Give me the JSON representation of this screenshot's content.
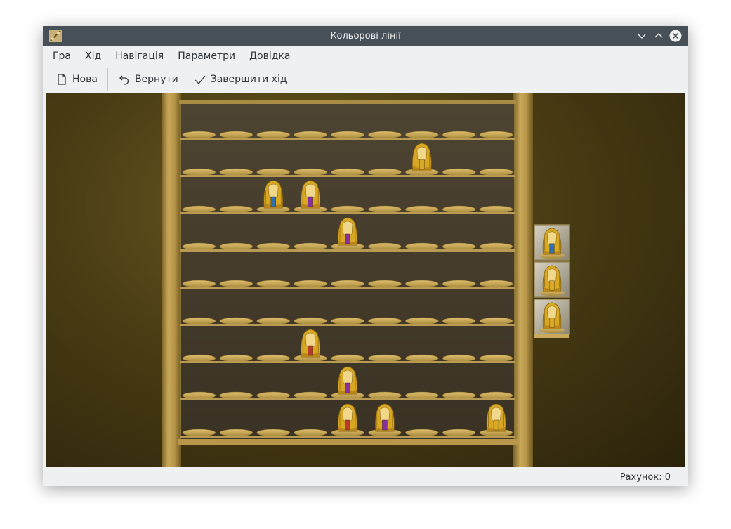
{
  "window": {
    "title": "Кольорові лінії"
  },
  "menu": {
    "items": [
      "Гра",
      "Хід",
      "Навігація",
      "Параметри",
      "Довідка"
    ]
  },
  "toolbar": {
    "new_label": "Нова",
    "undo_label": "Вернути",
    "end_turn_label": "Завершити хід"
  },
  "board": {
    "rows": 9,
    "cols": 9,
    "pieces": [
      {
        "row": 1,
        "col": 6,
        "color": "none"
      },
      {
        "row": 2,
        "col": 2,
        "color": "blue"
      },
      {
        "row": 2,
        "col": 3,
        "color": "purple"
      },
      {
        "row": 3,
        "col": 4,
        "color": "purple"
      },
      {
        "row": 6,
        "col": 3,
        "color": "red"
      },
      {
        "row": 7,
        "col": 4,
        "color": "purple"
      },
      {
        "row": 8,
        "col": 4,
        "color": "red"
      },
      {
        "row": 8,
        "col": 5,
        "color": "purple"
      },
      {
        "row": 8,
        "col": 8,
        "color": "none"
      }
    ],
    "next_pieces": [
      {
        "color": "blue"
      },
      {
        "color": "none"
      },
      {
        "color": "none"
      }
    ],
    "colors": {
      "blue": "#2f6fb0",
      "purple": "#8a2fa0",
      "red": "#b83a2a",
      "none": "#d8a928"
    }
  },
  "status": {
    "score_text": "Рахунок: 0"
  }
}
